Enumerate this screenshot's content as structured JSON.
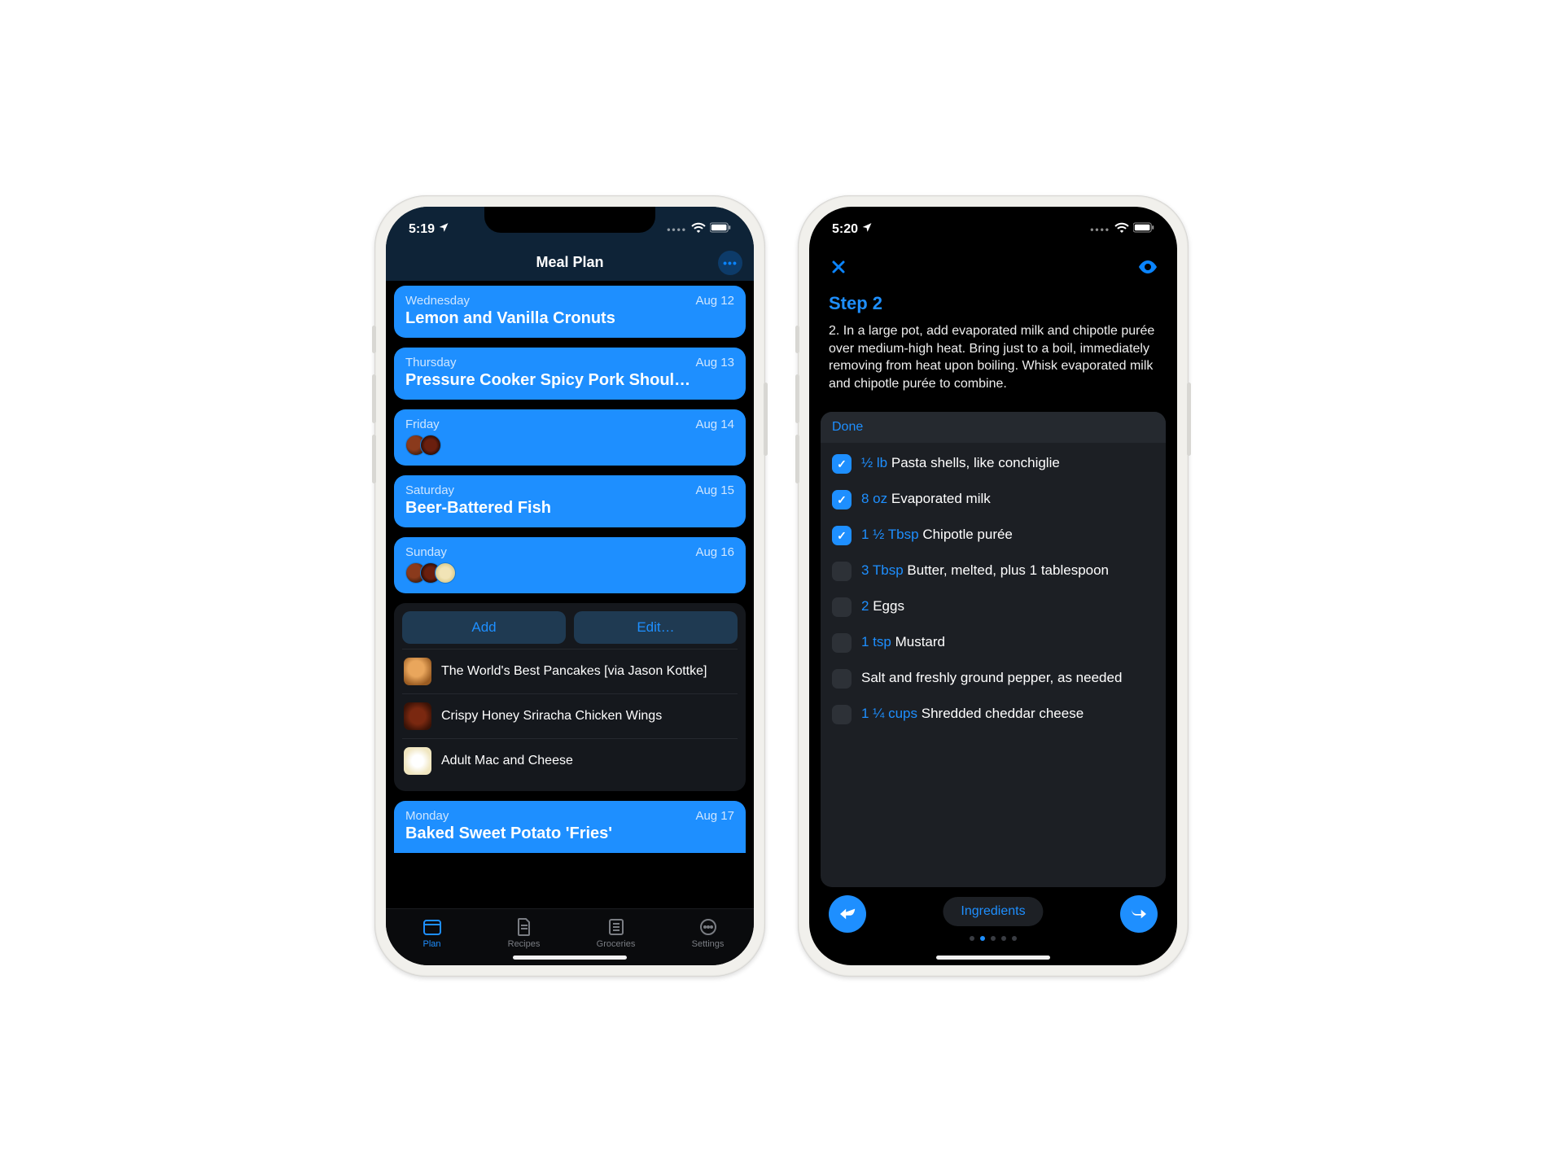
{
  "phone1": {
    "status": {
      "time": "5:19"
    },
    "nav": {
      "title": "Meal Plan"
    },
    "days": [
      {
        "day": "Wednesday",
        "date": "Aug 12",
        "title": "Lemon and Vanilla Cronuts"
      },
      {
        "day": "Thursday",
        "date": "Aug 13",
        "title": "Pressure Cooker Spicy Pork Shoul…"
      },
      {
        "day": "Friday",
        "date": "Aug 14",
        "title": ""
      },
      {
        "day": "Saturday",
        "date": "Aug 15",
        "title": "Beer-Battered Fish"
      },
      {
        "day": "Sunday",
        "date": "Aug 16",
        "title": ""
      }
    ],
    "actions": {
      "add": "Add",
      "edit": "Edit…"
    },
    "recipes": [
      "The World's Best Pancakes [via Jason Kottke]",
      "Crispy Honey Sriracha Chicken Wings",
      "Adult Mac and Cheese"
    ],
    "next_day": {
      "day": "Monday",
      "date": "Aug 17",
      "title": "Baked Sweet Potato 'Fries'"
    },
    "tabs": {
      "plan": "Plan",
      "recipes": "Recipes",
      "groceries": "Groceries",
      "settings": "Settings"
    }
  },
  "phone2": {
    "status": {
      "time": "5:20"
    },
    "step_label": "Step 2",
    "step_body": "2. In a large pot, add evaporated milk and chipotle purée over medium-high heat. Bring just to a boil, immediately removing from heat upon boiling. Whisk evaporated milk and chipotle purée to combine.",
    "done_label": "Done",
    "ingredients": [
      {
        "checked": true,
        "amount": "½ lb",
        "name": "Pasta shells, like conchiglie"
      },
      {
        "checked": true,
        "amount": "8 oz",
        "name": "Evaporated milk"
      },
      {
        "checked": true,
        "amount": "1 ½ Tbsp",
        "name": "Chipotle purée"
      },
      {
        "checked": false,
        "amount": "3 Tbsp",
        "name": "Butter, melted, plus 1 tablespoon"
      },
      {
        "checked": false,
        "amount": "2",
        "name": "Eggs"
      },
      {
        "checked": false,
        "amount": "1 tsp",
        "name": "Mustard"
      },
      {
        "checked": false,
        "amount": "",
        "name": "Salt and freshly ground pepper, as needed"
      },
      {
        "checked": false,
        "amount": "1 ¼ cups",
        "name": "Shredded cheddar cheese"
      }
    ],
    "bottom_label": "Ingredients"
  }
}
